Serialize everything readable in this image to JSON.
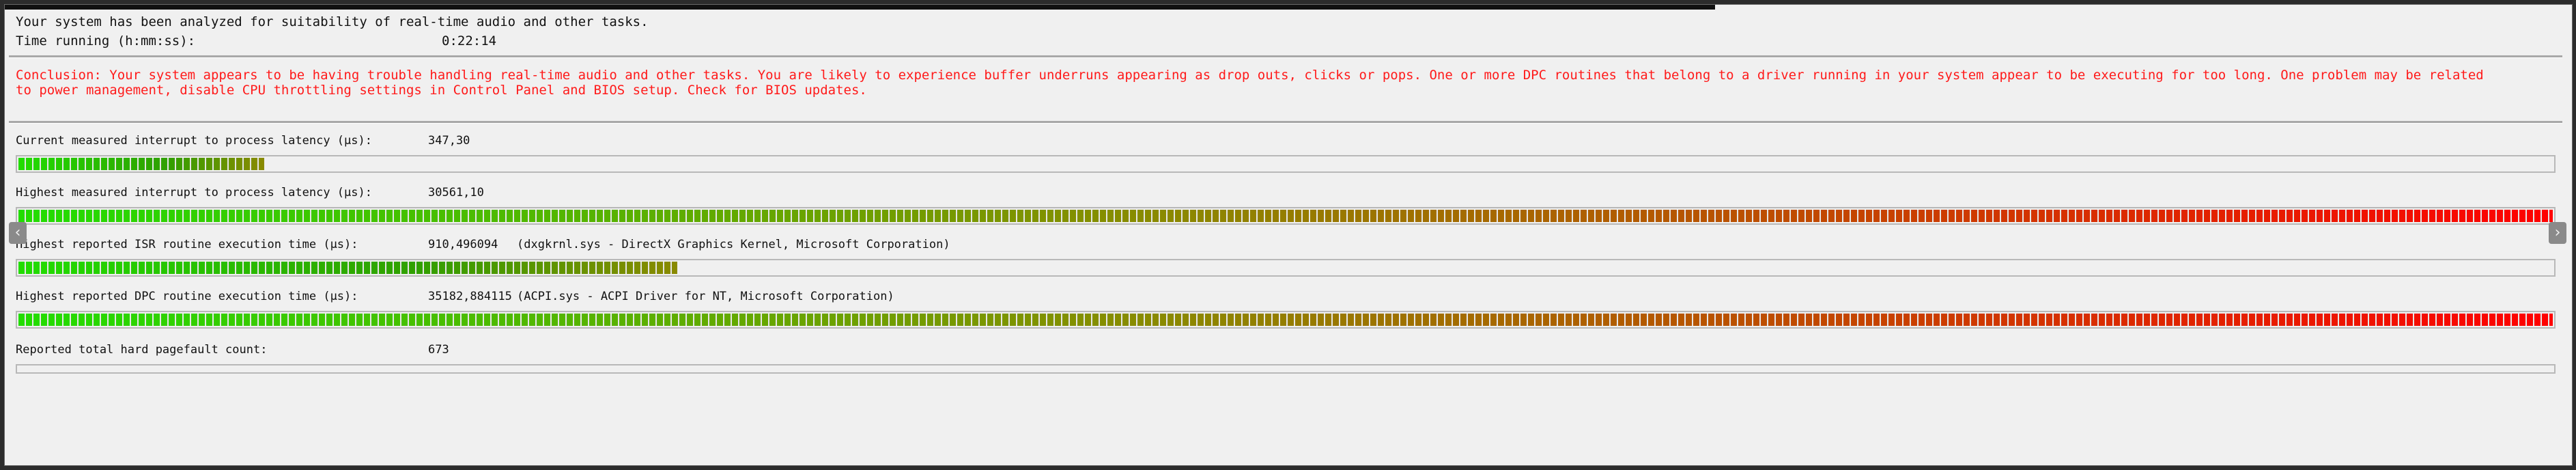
{
  "header": {
    "summary": "Your system has been analyzed for suitability of real-time audio and other tasks.",
    "time_label": "Time running (h:mm:ss):",
    "time_value": "0:22:14"
  },
  "conclusion": "Conclusion: Your system appears to be having trouble handling real-time audio and other tasks. You are likely to experience buffer underruns appearing as drop outs, clicks or pops. One or more DPC routines that belong to a driver running in your system appear to be executing for too long. One problem may be related to power management, disable CPU throttling settings in Control Panel and BIOS setup. Check for BIOS updates.",
  "metrics": [
    {
      "label": "Current measured interrupt to process latency (µs):",
      "value": "347,30",
      "detail": "",
      "level": 0.097
    },
    {
      "label": "Highest measured interrupt to process latency (µs):",
      "value": "30561,10",
      "detail": "",
      "level": 1.0
    },
    {
      "label": "Highest reported ISR routine execution time (µs):",
      "value": "910,496094",
      "detail": "(dxgkrnl.sys - DirectX Graphics Kernel, Microsoft Corporation)",
      "level": 0.26
    },
    {
      "label": "Highest reported DPC routine execution time (µs):",
      "value": "35182,884115",
      "detail": "(ACPI.sys - ACPI Driver for NT, Microsoft Corporation)",
      "level": 1.0
    },
    {
      "label": "Reported total hard pagefault count:",
      "value": "673",
      "detail": "",
      "level": 0.0
    }
  ],
  "colors": {
    "conclusion_text": "#ff1a1a",
    "bar_low": "#22dd00",
    "bar_mid": "#8a8a00",
    "bar_high": "#ff0000"
  },
  "icons": {
    "left_arrow": "chevron-left-icon",
    "right_arrow": "chevron-right-icon"
  }
}
